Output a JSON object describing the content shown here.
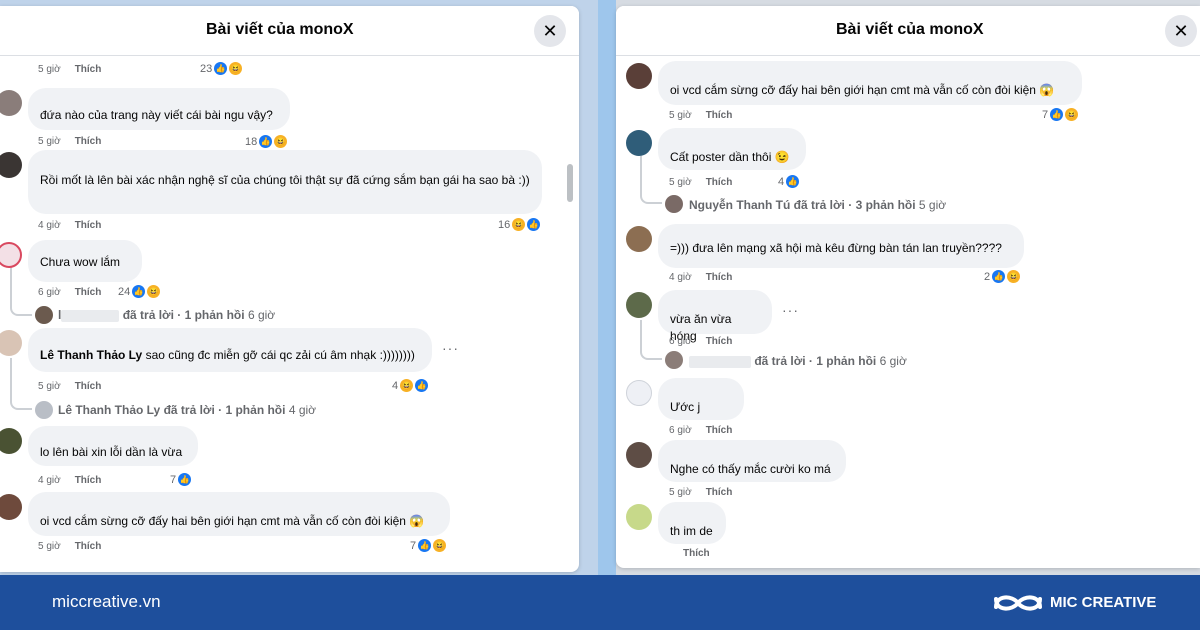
{
  "panel_left": {
    "title": "Bài viết của monoX",
    "comments": [
      {
        "time": "5 giờ",
        "like": "Thích",
        "count": "23"
      },
      {
        "text": "đứa nào của trang này viết cái bài ngu vậy?",
        "time": "5 giờ",
        "like": "Thích",
        "count": "18"
      },
      {
        "text": "Rồi mốt là lên bài xác nhận nghệ sĩ của chúng tôi thật sự đã cứng sắm bạn gái ha sao bà :))",
        "time": "4 giờ",
        "like": "Thích",
        "count": "16"
      },
      {
        "text": "Chưa wow lắm",
        "time": "6 giờ",
        "like": "Thích",
        "count": "24",
        "reply_action": "đã trả lời",
        "reply_count": "· 1 phản hồi",
        "reply_time": "6 giờ",
        "reply_initial": "l"
      },
      {
        "author": "Lê Thanh Thảo Ly",
        "text": "sao cũng đc miễn gỡ cái qc zải cú âm nhạk :))))))))",
        "time": "5 giờ",
        "like": "Thích",
        "count": "4",
        "reply_author": "Lê Thanh Thảo Ly",
        "reply_action": "đã trả lời",
        "reply_count": "· 1 phản hồi",
        "reply_time": "4 giờ"
      },
      {
        "text": "lo lên bài xin lỗi dần là vừa",
        "time": "4 giờ",
        "like": "Thích",
        "count": "7"
      },
      {
        "text": "oi vcd cắm sừng cỡ đấy hai bên giới hạn cmt mà vẫn cố còn đòi kiện",
        "time": "5 giờ",
        "like": "Thích",
        "count": "7"
      }
    ]
  },
  "panel_right": {
    "title": "Bài viết của monoX",
    "comments": [
      {
        "text": "oi vcd cắm sừng cỡ đấy hai bên giới hạn cmt mà vẫn cố còn đòi kiện",
        "time": "5 giờ",
        "like": "Thích",
        "count": "7"
      },
      {
        "text": "Cất poster dần thôi",
        "time": "5 giờ",
        "like": "Thích",
        "count": "4",
        "reply_author": "Nguyễn Thanh Tú",
        "reply_action": "đã trả lời",
        "reply_count": "· 3 phản hồi",
        "reply_time": "5 giờ"
      },
      {
        "text": "=))) đưa lên mạng xã hội mà kêu đừng bàn tán lan truyền????",
        "time": "4 giờ",
        "like": "Thích",
        "count": "2"
      },
      {
        "text": "vừa ăn vừa hóng",
        "time": "6 giờ",
        "like": "Thích",
        "reply_action": "đã trả lời",
        "reply_count": "· 1 phản hồi",
        "reply_time": "6 giờ"
      },
      {
        "text": "Ước j",
        "time": "6 giờ",
        "like": "Thích"
      },
      {
        "text": "Nghe có thấy mắc cười ko má",
        "time": "5 giờ",
        "like": "Thích"
      },
      {
        "text": "th im de",
        "time": "",
        "like": "Thích"
      }
    ]
  },
  "footer": {
    "url": "miccreative.vn",
    "brand": "MIC CREATIVE"
  },
  "colors": {
    "footer_bg": "#1e4f9c",
    "like_blue": "#1877f2",
    "bubble_bg": "#f0f2f5",
    "meta_gray": "#65676b"
  },
  "icons": [
    "close-icon",
    "like-reaction-icon",
    "haha-reaction-icon",
    "wow-reaction-icon",
    "more-options-icon",
    "brand-logo-icon"
  ]
}
